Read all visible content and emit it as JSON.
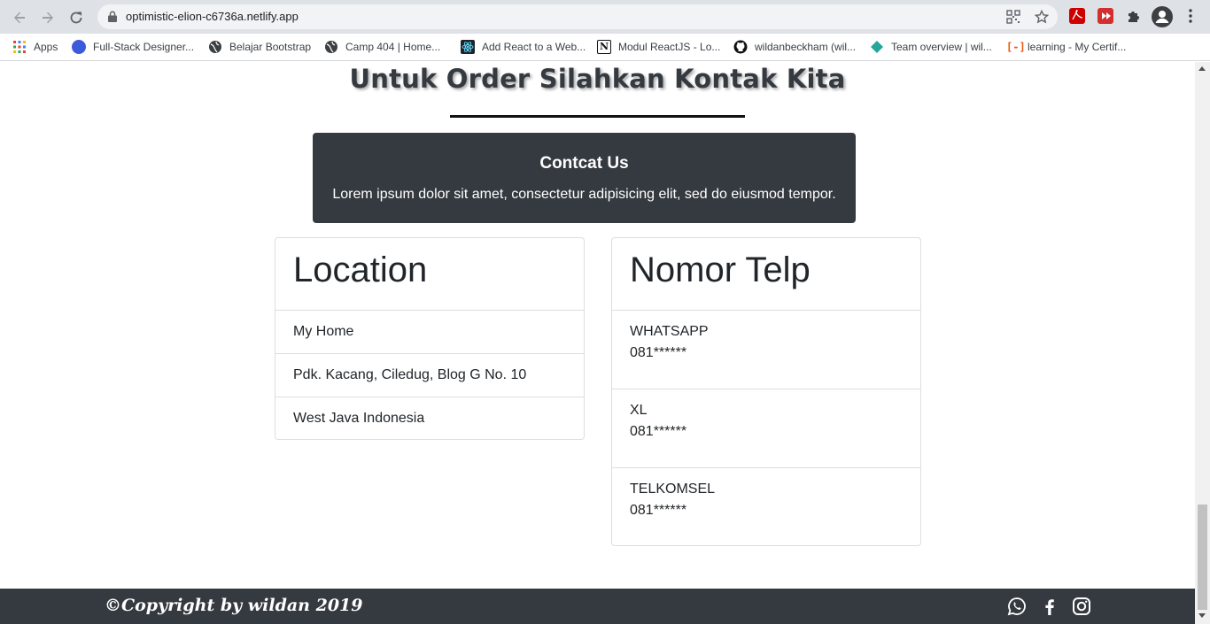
{
  "browser": {
    "url": "optimistic-elion-c6736a.netlify.app",
    "bookmarks": [
      {
        "label": "Apps",
        "icon": "apps-grid-icon"
      },
      {
        "label": "Full-Stack Designer...",
        "icon": "site-icon"
      },
      {
        "label": "Belajar Bootstrap",
        "icon": "globe-icon"
      },
      {
        "label": "Camp 404 | Home...",
        "icon": "globe-icon"
      },
      {
        "label": "Add React to a Web...",
        "icon": "react-icon"
      },
      {
        "label": "Modul ReactJS - Lo...",
        "icon": "notion-icon"
      },
      {
        "label": "wildanbeckham (wil...",
        "icon": "github-icon"
      },
      {
        "label": "Team overview | wil...",
        "icon": "diamond-icon"
      },
      {
        "label": "learning - My Certif...",
        "icon": "codeigniter-icon"
      }
    ]
  },
  "page": {
    "heading": "Untuk Order Silahkan Kontak Kita",
    "contact": {
      "title": "Contcat Us",
      "text": "Lorem ipsum dolor sit amet, consectetur adipisicing elit, sed do eiusmod tempor."
    },
    "location": {
      "title": "Location",
      "items": [
        "My Home",
        "Pdk. Kacang, Ciledug, Blog G No. 10",
        "West Java Indonesia"
      ]
    },
    "phone": {
      "title": "Nomor Telp",
      "items": [
        {
          "label": "WHATSAPP",
          "number": "081******"
        },
        {
          "label": "XL",
          "number": "081******"
        },
        {
          "label": "TELKOMSEL",
          "number": "081******"
        }
      ]
    },
    "footer": {
      "copyright": "Copyright by wildan 2019",
      "social": [
        "whatsapp-icon",
        "facebook-icon",
        "instagram-icon"
      ]
    }
  },
  "colors": {
    "dark": "#343a40",
    "chrome": "#dee1e6"
  }
}
